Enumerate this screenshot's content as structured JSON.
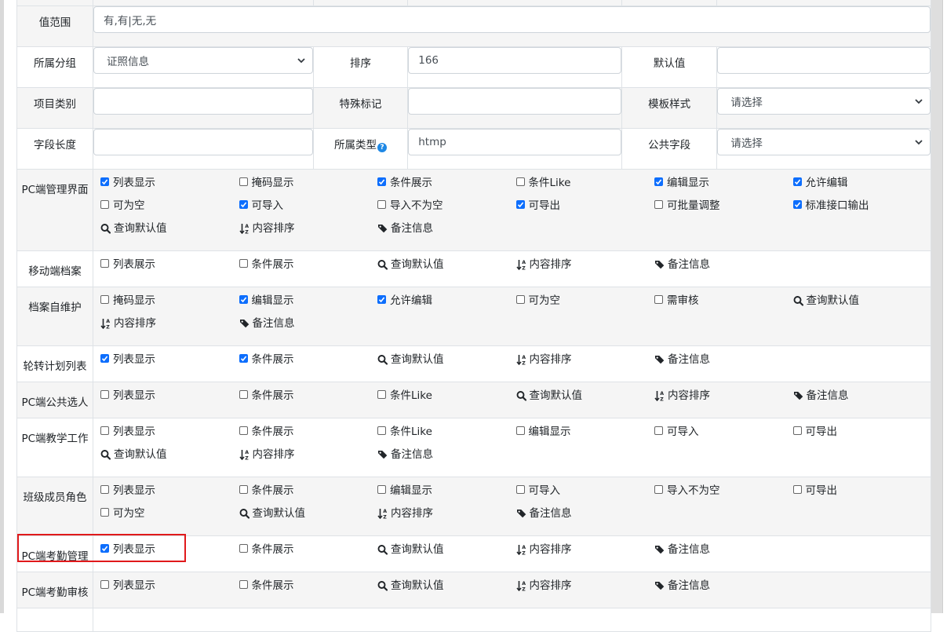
{
  "fields": {
    "value_range": {
      "label": "值范围",
      "value": "有,有|无,无"
    },
    "group": {
      "label": "所属分组",
      "selected": "证照信息"
    },
    "sort": {
      "label": "排序",
      "value": "166"
    },
    "default_value": {
      "label": "默认值",
      "value": ""
    },
    "item_type": {
      "label": "项目类别",
      "value": ""
    },
    "special_mark": {
      "label": "特殊标记",
      "value": ""
    },
    "template_style": {
      "label": "模板样式",
      "selected": "请选择"
    },
    "field_length": {
      "label": "字段长度",
      "value": ""
    },
    "owner_type": {
      "label": "所属类型",
      "value": "htmp",
      "help_icon": "question-circle-icon"
    },
    "public_field": {
      "label": "公共字段",
      "selected": "请选择"
    }
  },
  "icons": {
    "query_default": "search-icon",
    "content_sort": "sort-alpha-icon",
    "remark": "tag-icon"
  },
  "accent_color": "#0d6efd",
  "highlight_color": "#e0191b",
  "sections": [
    {
      "label": "PC端管理界面",
      "options": [
        {
          "type": "check",
          "label": "列表显示",
          "checked": true
        },
        {
          "type": "check",
          "label": "掩码显示",
          "checked": false
        },
        {
          "type": "check",
          "label": "条件展示",
          "checked": true
        },
        {
          "type": "check",
          "label": "条件Like",
          "checked": false
        },
        {
          "type": "check",
          "label": "编辑显示",
          "checked": true
        },
        {
          "type": "check",
          "label": "允许编辑",
          "checked": true
        },
        {
          "type": "check",
          "label": "可为空",
          "checked": false
        },
        {
          "type": "check",
          "label": "可导入",
          "checked": true
        },
        {
          "type": "check",
          "label": "导入不为空",
          "checked": false
        },
        {
          "type": "check",
          "label": "可导出",
          "checked": true
        },
        {
          "type": "check",
          "label": "可批量调整",
          "checked": false
        },
        {
          "type": "check",
          "label": "标准接口输出",
          "checked": true
        },
        {
          "type": "search",
          "label": "查询默认值"
        },
        {
          "type": "sort",
          "label": "内容排序"
        },
        {
          "type": "tag",
          "label": "备注信息"
        }
      ]
    },
    {
      "label": "移动端档案",
      "options": [
        {
          "type": "check",
          "label": "列表展示",
          "checked": false
        },
        {
          "type": "check",
          "label": "条件展示",
          "checked": false
        },
        {
          "type": "search",
          "label": "查询默认值"
        },
        {
          "type": "sort",
          "label": "内容排序"
        },
        {
          "type": "tag",
          "label": "备注信息"
        }
      ]
    },
    {
      "label": "档案自维护",
      "options": [
        {
          "type": "check",
          "label": "掩码显示",
          "checked": false
        },
        {
          "type": "check",
          "label": "编辑显示",
          "checked": true
        },
        {
          "type": "check",
          "label": "允许编辑",
          "checked": true
        },
        {
          "type": "check",
          "label": "可为空",
          "checked": false
        },
        {
          "type": "check",
          "label": "需审核",
          "checked": false
        },
        {
          "type": "search",
          "label": "查询默认值"
        },
        {
          "type": "sort",
          "label": "内容排序"
        },
        {
          "type": "tag",
          "label": "备注信息"
        }
      ]
    },
    {
      "label": "轮转计划列表",
      "options": [
        {
          "type": "check",
          "label": "列表显示",
          "checked": true
        },
        {
          "type": "check",
          "label": "条件展示",
          "checked": true
        },
        {
          "type": "search",
          "label": "查询默认值"
        },
        {
          "type": "sort",
          "label": "内容排序"
        },
        {
          "type": "tag",
          "label": "备注信息"
        }
      ]
    },
    {
      "label": "PC端公共选人",
      "options": [
        {
          "type": "check",
          "label": "列表显示",
          "checked": false
        },
        {
          "type": "check",
          "label": "条件展示",
          "checked": false
        },
        {
          "type": "check",
          "label": "条件Like",
          "checked": false
        },
        {
          "type": "search",
          "label": "查询默认值"
        },
        {
          "type": "sort",
          "label": "内容排序"
        },
        {
          "type": "tag",
          "label": "备注信息"
        }
      ]
    },
    {
      "label": "PC端教学工作",
      "options": [
        {
          "type": "check",
          "label": "列表显示",
          "checked": false
        },
        {
          "type": "check",
          "label": "条件展示",
          "checked": false
        },
        {
          "type": "check",
          "label": "条件Like",
          "checked": false
        },
        {
          "type": "check",
          "label": "编辑显示",
          "checked": false
        },
        {
          "type": "check",
          "label": "可导入",
          "checked": false
        },
        {
          "type": "check",
          "label": "可导出",
          "checked": false
        },
        {
          "type": "search",
          "label": "查询默认值"
        },
        {
          "type": "sort",
          "label": "内容排序"
        },
        {
          "type": "tag",
          "label": "备注信息"
        }
      ]
    },
    {
      "label": "班级成员角色",
      "options": [
        {
          "type": "check",
          "label": "列表显示",
          "checked": false
        },
        {
          "type": "check",
          "label": "条件展示",
          "checked": false
        },
        {
          "type": "check",
          "label": "编辑显示",
          "checked": false
        },
        {
          "type": "check",
          "label": "可导入",
          "checked": false
        },
        {
          "type": "check",
          "label": "导入不为空",
          "checked": false
        },
        {
          "type": "check",
          "label": "可导出",
          "checked": false
        },
        {
          "type": "check",
          "label": "可为空",
          "checked": false
        },
        {
          "type": "search",
          "label": "查询默认值"
        },
        {
          "type": "sort",
          "label": "内容排序"
        },
        {
          "type": "tag",
          "label": "备注信息"
        }
      ]
    },
    {
      "label": "PC端考勤管理",
      "options": [
        {
          "type": "check",
          "label": "列表显示",
          "checked": true
        },
        {
          "type": "check",
          "label": "条件展示",
          "checked": false
        },
        {
          "type": "search",
          "label": "查询默认值"
        },
        {
          "type": "sort",
          "label": "内容排序"
        },
        {
          "type": "tag",
          "label": "备注信息"
        }
      ]
    },
    {
      "label": "PC端考勤审核",
      "options": [
        {
          "type": "check",
          "label": "列表显示",
          "checked": false
        },
        {
          "type": "check",
          "label": "条件展示",
          "checked": false
        },
        {
          "type": "search",
          "label": "查询默认值"
        },
        {
          "type": "sort",
          "label": "内容排序"
        },
        {
          "type": "tag",
          "label": "备注信息"
        }
      ]
    }
  ]
}
